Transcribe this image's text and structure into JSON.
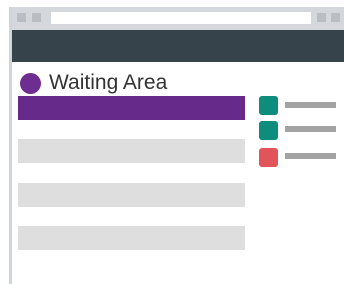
{
  "window": {
    "chrome_buttons": [
      "window-dot",
      "window-dot"
    ],
    "toolbar_color": "#37434b"
  },
  "page": {
    "title": "Waiting Area",
    "title_dot_color": "#6e2d91"
  },
  "queue": {
    "active_color": "#652a8a",
    "inactive_color": "#dedede",
    "rows": [
      {
        "state": "active"
      },
      {
        "state": "inactive"
      },
      {
        "state": "inactive"
      },
      {
        "state": "inactive"
      }
    ]
  },
  "legend": {
    "items": [
      {
        "color": "#0e8d7d",
        "icon": "teal-square-icon"
      },
      {
        "color": "#0e8d7d",
        "icon": "teal-square-icon"
      },
      {
        "color": "#e0545a",
        "icon": "red-square-icon"
      }
    ]
  }
}
